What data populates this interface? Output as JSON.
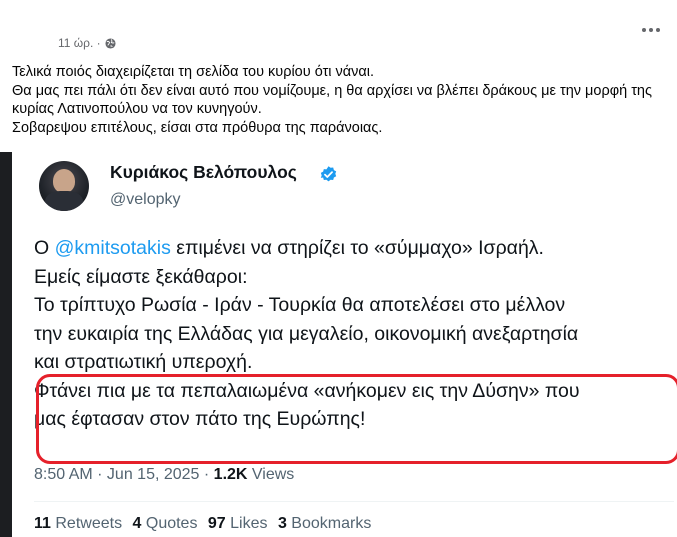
{
  "post": {
    "timestamp": "11 ώρ. ·",
    "text_lines": [
      "Τελικά ποιός διαχειρίζεται τη σελίδα του κυρίου ότι νάναι.",
      "Θα μας πει πάλι ότι δεν είναι αυτό που νομίζουμε, η θα αρχίσει να βλέπει δράκους με την μορφή της κυρίας Λατινοπούλου να τον κυνηγούν.",
      "Σοβαρεψου επιτέλους, είσαι στα πρόθυρα της παράνοιας."
    ]
  },
  "tweet": {
    "author_name": "Κυριάκος Βελόπουλος",
    "handle": "@velopky",
    "line1_prefix": "Ο ",
    "line1_mention": "@kmitsotakis",
    "line1_suffix": " επιμένει να στηρίζει το «σύμμαχο» Ισραήλ.",
    "line2": "Εμείς είμαστε ξεκάθαροι:",
    "line3": "Το τρίπτυχο Ρωσία - Ιράν - Τουρκία θα αποτελέσει στο μέλλον",
    "line4": "την ευκαιρία της Ελλάδας για μεγαλείο, οικονομική ανεξαρτησία",
    "line5": "και στρατιωτική υπεροχή.",
    "line6": "Φτάνει πια με τα πεπαλαιωμένα «ανήκομεν εις την Δύσην» που",
    "line7": "μας έφτασαν στον πάτο της Ευρώπης!",
    "time": "8:50 AM · Jun 15, 2025 · ",
    "views_count": "1.2K",
    "views_label": " Views",
    "retweets_count": "11",
    "retweets_label": " Retweets",
    "quotes_count": "4",
    "quotes_label": " Quotes",
    "likes_count": "97",
    "likes_label": " Likes",
    "bookmarks_count": "3",
    "bookmarks_label": " Bookmarks"
  },
  "colors": {
    "mention": "#1d9bf0",
    "highlight": "#e5202a",
    "verified": "#1d9bf0"
  },
  "icons": [
    "globe-icon",
    "more-options-icon",
    "verified-badge-icon"
  ]
}
